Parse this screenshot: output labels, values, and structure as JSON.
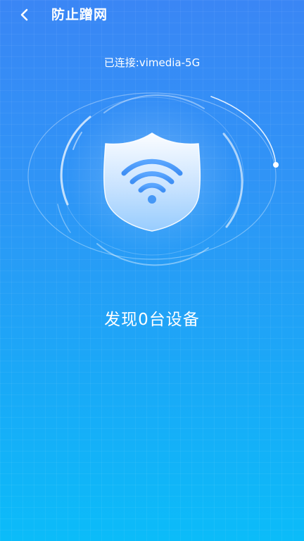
{
  "header": {
    "title": "防止蹭网",
    "back_icon": "chevron-left-icon"
  },
  "connection": {
    "status_text": "已连接:vimedia-5G"
  },
  "scan": {
    "result_text": "发现0台设备",
    "shield_icon": "wifi-shield-icon"
  },
  "colors": {
    "background_top": "#3a86f5",
    "background_bottom": "#0bbcf9",
    "text": "#ffffff"
  }
}
